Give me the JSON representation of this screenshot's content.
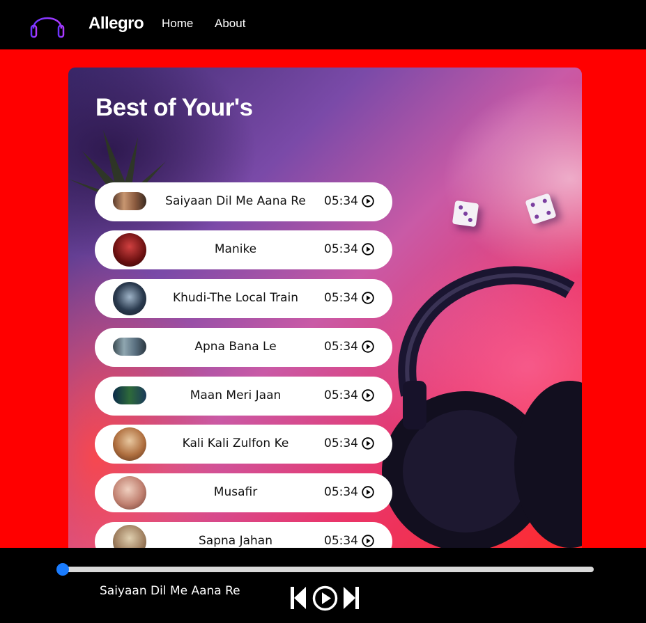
{
  "navbar": {
    "brand": "Allegro",
    "links": [
      "Home",
      "About"
    ]
  },
  "main": {
    "heading": "Best of Your's",
    "songs": [
      {
        "title": "Saiyaan Dil Me Aana Re",
        "duration": "05:34"
      },
      {
        "title": "Manike",
        "duration": "05:34"
      },
      {
        "title": "Khudi-The Local Train",
        "duration": "05:34"
      },
      {
        "title": "Apna Bana Le",
        "duration": "05:34"
      },
      {
        "title": "Maan Meri Jaan",
        "duration": "05:34"
      },
      {
        "title": "Kali Kali Zulfon Ke",
        "duration": "05:34"
      },
      {
        "title": "Musafir",
        "duration": "05:34"
      },
      {
        "title": "Sapna Jahan",
        "duration": "05:34"
      }
    ]
  },
  "player": {
    "now_playing": "Saiyaan Dil Me Aana Re",
    "progress": 0,
    "controls": [
      "previous-icon",
      "play-icon",
      "next-icon"
    ]
  },
  "colors": {
    "page_background": "#ff0000",
    "navbar": "#000000",
    "slider_thumb": "#1a7cff"
  }
}
